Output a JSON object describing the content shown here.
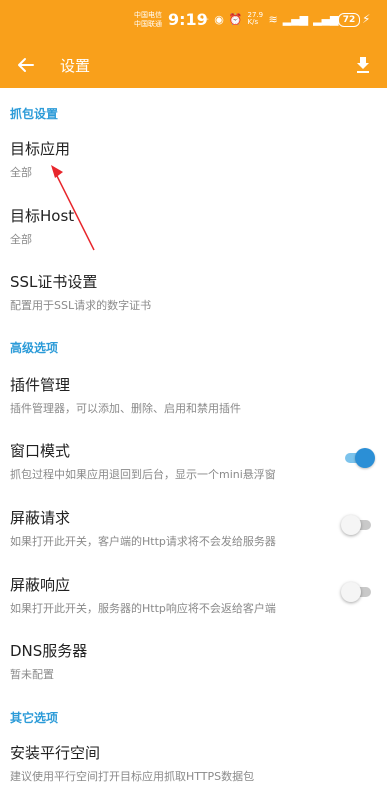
{
  "status_bar": {
    "carrier1": "中国电信",
    "carrier2": "中国联通",
    "time": "9:19",
    "speed": "27.9 K/s",
    "battery": "72"
  },
  "app_bar": {
    "title": "设置"
  },
  "sections": {
    "capture": "抓包设置",
    "advanced": "高级选项",
    "other": "其它选项"
  },
  "items": {
    "target_app": {
      "title": "目标应用",
      "subtitle": "全部"
    },
    "target_host": {
      "title": "目标Host",
      "subtitle": "全部"
    },
    "ssl": {
      "title": "SSL证书设置",
      "subtitle": "配置用于SSL请求的数字证书"
    },
    "plugins": {
      "title": "插件管理",
      "subtitle": "插件管理器，可以添加、删除、启用和禁用插件"
    },
    "window_mode": {
      "title": "窗口模式",
      "subtitle": "抓包过程中如果应用退回到后台，显示一个mini悬浮窗",
      "enabled": true
    },
    "block_request": {
      "title": "屏蔽请求",
      "subtitle": "如果打开此开关，客户端的Http请求将不会发给服务器",
      "enabled": false
    },
    "block_response": {
      "title": "屏蔽响应",
      "subtitle": "如果打开此开关，服务器的Http响应将不会返给客户端",
      "enabled": false
    },
    "dns": {
      "title": "DNS服务器",
      "subtitle": "暂未配置"
    },
    "parallel_space": {
      "title": "安装平行空间",
      "subtitle": "建议使用平行空间打开目标应用抓取HTTPS数据包"
    }
  },
  "colors": {
    "accent": "#f9a01b",
    "section_text": "#2c9bd8",
    "toggle_on": "#2b8fd6",
    "annotation_arrow": "#e8262c"
  },
  "icons": {
    "back": "arrow-left-icon",
    "download": "download-icon"
  }
}
